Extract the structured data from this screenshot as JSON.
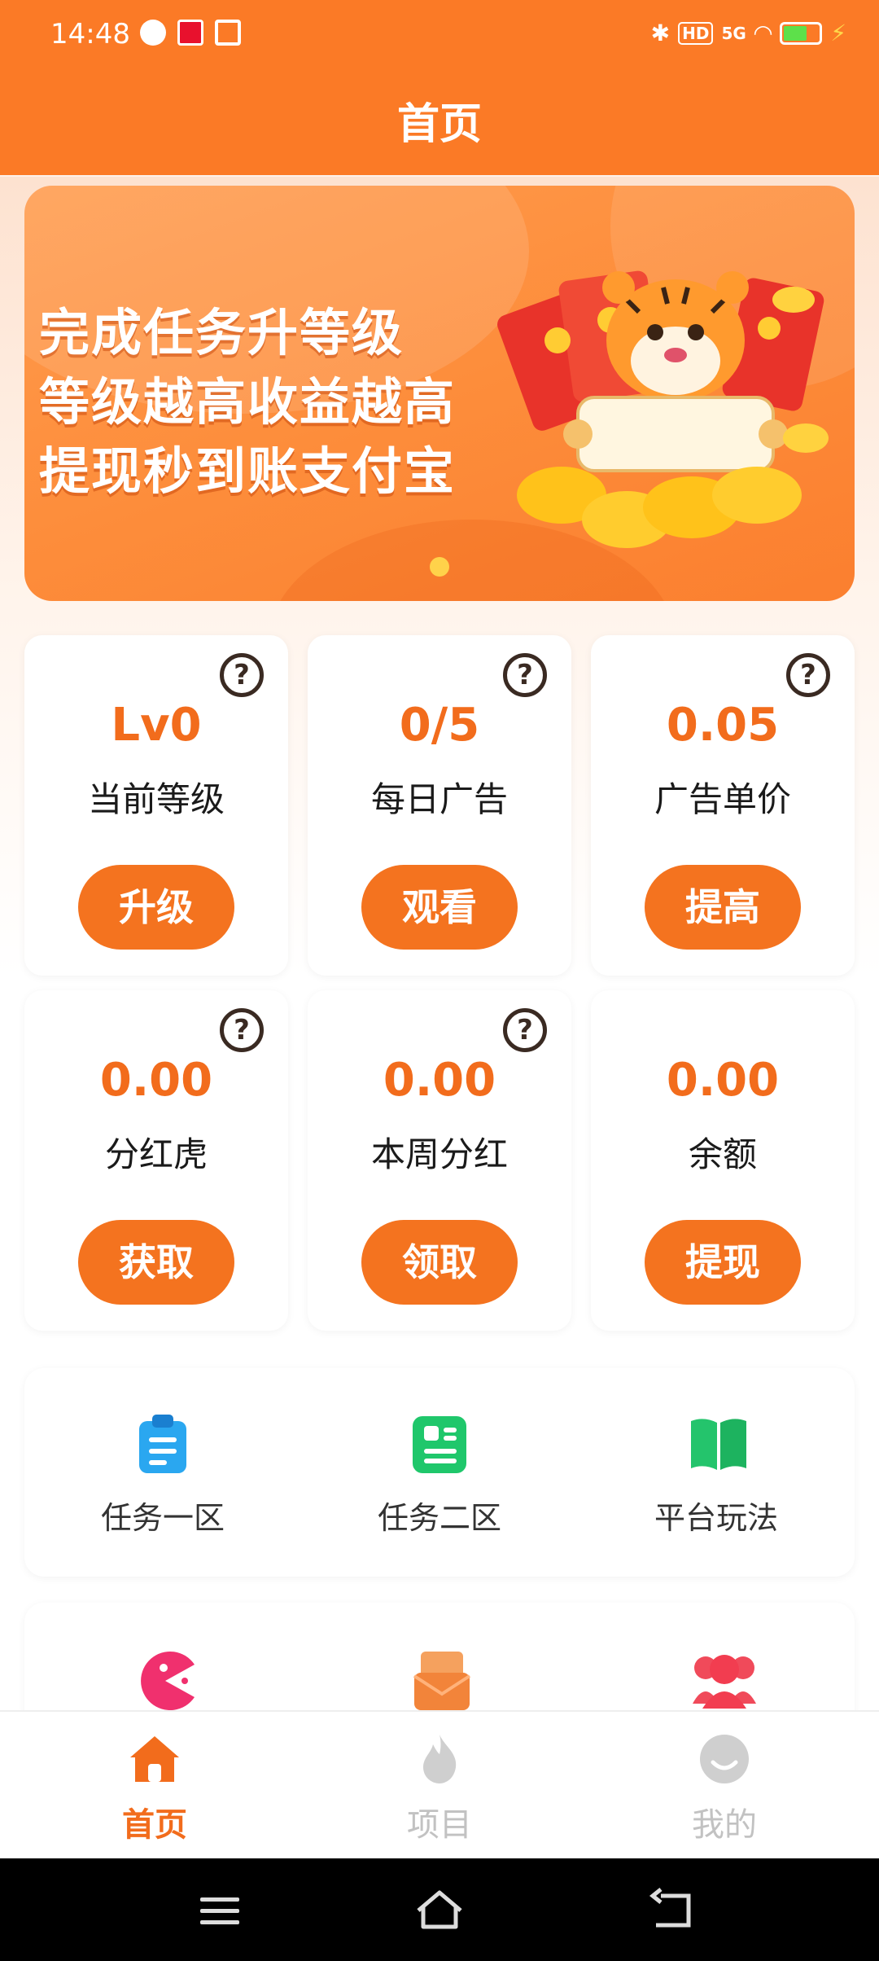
{
  "status_bar": {
    "time": "14:48",
    "left_icons": [
      "check-circle-icon",
      "app-badge-icon",
      "gift-icon"
    ],
    "right_icons": [
      "bluetooth-icon",
      "hd-icon",
      "signal-5g-icon",
      "wifi-icon",
      "battery-icon",
      "charging-icon"
    ],
    "network_label": "5G",
    "hd_label": "HD"
  },
  "header": {
    "title": "首页"
  },
  "banner": {
    "lines": [
      "完成任务升等级",
      "等级越高收益越高",
      "提现秒到账支付宝"
    ],
    "active_dot": 0
  },
  "stats": [
    {
      "value": "Lv0",
      "label": "当前等级",
      "button": "升级",
      "help": true
    },
    {
      "value": "0/5",
      "label": "每日广告",
      "button": "观看",
      "help": true
    },
    {
      "value": "0.05",
      "label": "广告单价",
      "button": "提高",
      "help": true
    },
    {
      "value": "0.00",
      "label": "分红虎",
      "button": "获取",
      "help": true
    },
    {
      "value": "0.00",
      "label": "本周分红",
      "button": "领取",
      "help": true
    },
    {
      "value": "0.00",
      "label": "余额",
      "button": "提现",
      "help": false
    }
  ],
  "help_glyph": "?",
  "menu": {
    "items": [
      {
        "label": "任务一区",
        "icon": "clipboard-icon"
      },
      {
        "label": "任务二区",
        "icon": "list-doc-icon"
      },
      {
        "label": "平台玩法",
        "icon": "book-icon"
      }
    ],
    "row2_icons": [
      "pacman-icon",
      "mail-icon",
      "users-icon"
    ]
  },
  "bottom_nav": {
    "items": [
      {
        "label": "首页",
        "icon": "home-icon",
        "active": true
      },
      {
        "label": "项目",
        "icon": "flame-icon",
        "active": false
      },
      {
        "label": "我的",
        "icon": "smile-icon",
        "active": false
      }
    ]
  },
  "colors": {
    "brand": "#fb7a26",
    "accent_text": "#f26c1c",
    "button": "#f4731f"
  }
}
